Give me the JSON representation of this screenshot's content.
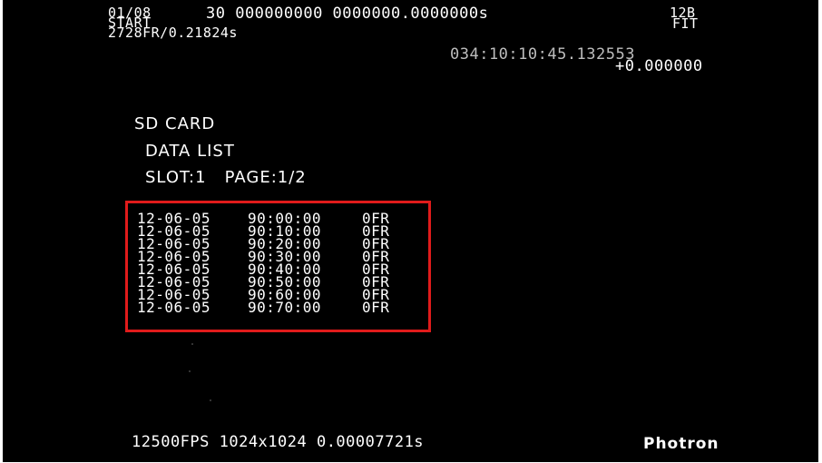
{
  "header": {
    "frame_index": "01/08",
    "mode": "START",
    "frame_info": "2728FR/0.21824s",
    "top_numbers": "30 000000000 0000000.0000000s",
    "bit_depth": "12B",
    "fit": "FIT",
    "timestamp": "034:10:10:45.132553",
    "offset": "+0.000000"
  },
  "menu": {
    "title": "SD CARD",
    "subtitle": "DATA LIST",
    "slot_page": "SLOT:1   PAGE:1/2"
  },
  "data_list": [
    {
      "date": "12-06-05",
      "time": "90:00:00",
      "frames": "0FR"
    },
    {
      "date": "12-06-05",
      "time": "90:10:00",
      "frames": "0FR"
    },
    {
      "date": "12-06-05",
      "time": "90:20:00",
      "frames": "0FR"
    },
    {
      "date": "12-06-05",
      "time": "90:30:00",
      "frames": "0FR"
    },
    {
      "date": "12-06-05",
      "time": "90:40:00",
      "frames": "0FR"
    },
    {
      "date": "12-06-05",
      "time": "90:50:00",
      "frames": "0FR"
    },
    {
      "date": "12-06-05",
      "time": "90:60:00",
      "frames": "0FR"
    },
    {
      "date": "12-06-05",
      "time": "90:70:00",
      "frames": "0FR"
    }
  ],
  "footer": {
    "settings": "12500FPS 1024x1024 0.00007721s",
    "brand": "Photron"
  },
  "colors": {
    "background": "#000000",
    "text": "#ffffff",
    "highlight_border": "#e01b1b"
  }
}
